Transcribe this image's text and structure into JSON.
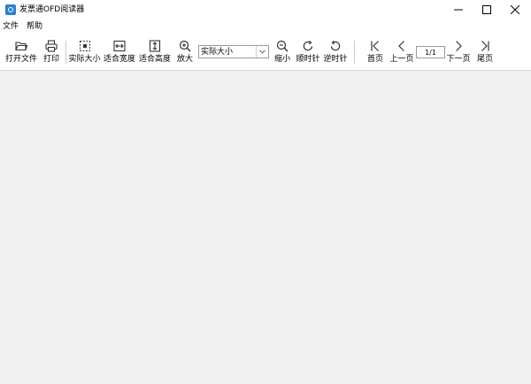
{
  "window": {
    "title": "发票通OFD阅读器"
  },
  "menu": {
    "items": [
      {
        "label": "文件"
      },
      {
        "label": "帮助"
      }
    ]
  },
  "toolbar": {
    "open": "打开文件",
    "print": "打印",
    "actual_size": "实际大小",
    "fit_width": "适合宽度",
    "fit_height": "适合高度",
    "zoom_in": "放大",
    "zoom_select_value": "实际大小",
    "zoom_out": "缩小",
    "rotate_cw": "顺时针",
    "rotate_ccw": "逆时针",
    "first_page": "首页",
    "prev_page": "上一页",
    "page_input_value": "1/1",
    "next_page": "下一页",
    "last_page": "尾页"
  },
  "colors": {
    "app_icon": "#2b7fd0",
    "toolbar_bg": "#ffffff",
    "workspace_bg": "#f0f0f0"
  }
}
